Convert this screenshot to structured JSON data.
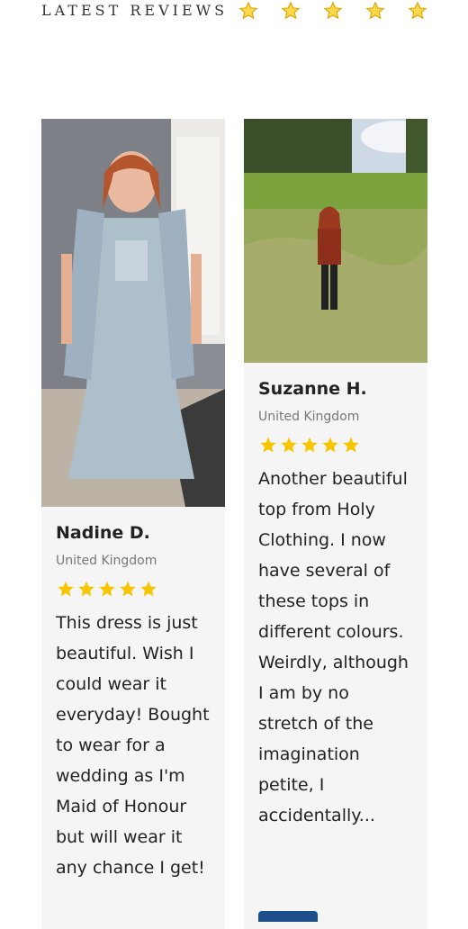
{
  "section": {
    "title": "LATEST REVIEWS",
    "star_count": 5
  },
  "colors": {
    "star_gold": "#f7c600",
    "card_background": "#f5f5f5"
  },
  "reviews": [
    {
      "name": "Nadine D.",
      "country": "United Kingdom",
      "rating": 5,
      "text": "This dress is just beautiful. Wish I could wear it everyday! Bought to wear for a wedding as I'm Maid of Honour but will wear it any chance I get!"
    },
    {
      "name": "Suzanne H.",
      "country": "United Kingdom",
      "rating": 5,
      "text": "Another beautiful top from Holy Clothing. I now have several of these tops in different colours. Weirdly, although I am by no stretch of the imagination petite, I accidentally..."
    }
  ]
}
